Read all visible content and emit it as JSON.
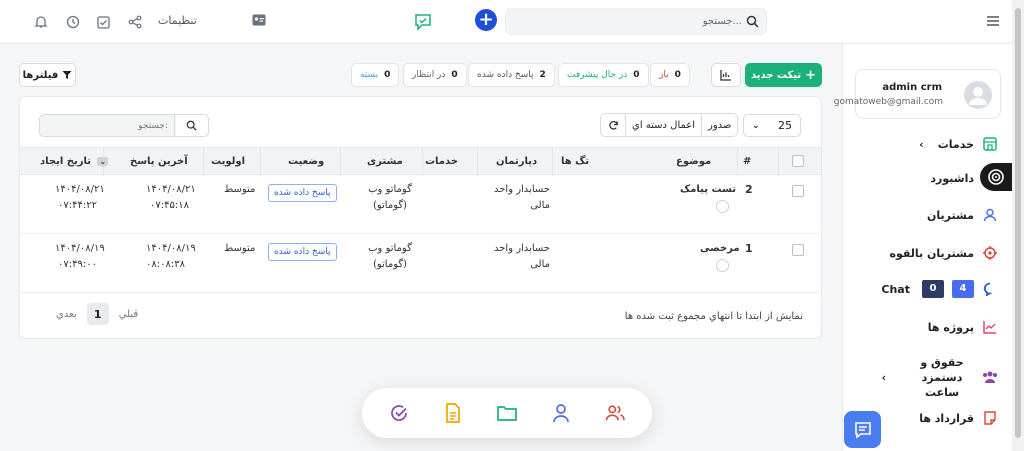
{
  "topbar": {
    "settings_label": "تنظیمات",
    "search_placeholder": "جستجو...",
    "icons": [
      "bell-icon",
      "clock-icon",
      "checkbox-icon",
      "share-icon",
      "id-card-icon",
      "chat-icon",
      "plus-icon",
      "search-icon",
      "hamburger-icon"
    ]
  },
  "colors": {
    "primary": "#1f4fd6",
    "success": "#1bb17a",
    "accent_blue": "#4a7df0"
  },
  "toolbar": {
    "filters_label": "فیلترها",
    "new_ticket_label": "تیکت جدید",
    "statuses": [
      {
        "label": "بسته",
        "count": "0",
        "color": "#2aa7c9"
      },
      {
        "label": "در انتظار",
        "count": "0",
        "color": "#666666"
      },
      {
        "label": "پاسخ داده شده",
        "count": "2",
        "color": "#555555"
      },
      {
        "label": "در حال پیشرفت",
        "count": "0",
        "color": "#1bb17a"
      },
      {
        "label": "باز",
        "count": "0",
        "color": "#e0453a"
      }
    ]
  },
  "panel": {
    "search_placeholder": "جستجو:",
    "bulk_action_label": "اعمال دسته اي",
    "export_label": "صدور",
    "per_page": "25",
    "columns": {
      "num": "#",
      "subject": "موضوع",
      "tags": "تگ ها",
      "department": "دپارتمان",
      "services": "خدمات",
      "customer": "مشتری",
      "status": "وضعیت",
      "priority": "اولویت",
      "last_reply": "آخرین پاسخ",
      "created": "تاریخ ایجاد"
    },
    "rows": [
      {
        "num": "2",
        "subject": "تست پیامک",
        "department": "حسابدار واحد مالی",
        "customer": "گوماتو وب (گوماتو)",
        "status": "پاسخ داده شده",
        "priority": "متوسط",
        "last_reply_date": "۱۴۰۴/۰۸/۲۱",
        "last_reply_time": "۰۷:۴۵:۱۸",
        "created_date": "۱۴۰۴/۰۸/۲۱",
        "created_time": "۰۷:۴۴:۲۲"
      },
      {
        "num": "1",
        "subject": "مرخصی",
        "department": "حسابدار واحد مالی",
        "customer": "گوماتو وب (گوماتو)",
        "status": "پاسخ داده شده",
        "priority": "متوسط",
        "last_reply_date": "۱۴۰۴/۰۸/۱۹",
        "last_reply_time": "۰۸:۰۸:۳۸",
        "created_date": "۱۴۰۴/۰۸/۱۹",
        "created_time": "۰۷:۴۹:۰۰"
      }
    ],
    "footer_info": "نمایش از ابتدا تا انتهاي مجموع ثبت شده ها",
    "pager": {
      "prev": "قبلي",
      "current": "1",
      "next": "بعدي"
    }
  },
  "sidebar": {
    "profile": {
      "name": "admin crm",
      "email": "gomatoweb@gmail.com"
    },
    "items": [
      {
        "label": "خدمات",
        "icon": "store-icon",
        "color": "#1bb17a"
      },
      {
        "label": "داشبورد",
        "icon": "dashboard-icon",
        "color": "#f0a500"
      },
      {
        "label": "مشتریان",
        "icon": "user-icon",
        "color": "#4a6cf0"
      },
      {
        "label": "مشتریان بالقوه",
        "icon": "crosshair-icon",
        "color": "#e0453a"
      },
      {
        "label": "Chat",
        "icon": "chat-bubble-icon",
        "color": "#2c62c9",
        "badge_a": "4",
        "badge_b": "0"
      },
      {
        "label": "پروژه ها",
        "icon": "chart-icon",
        "color": "#e0457b"
      },
      {
        "label": "حقوق و دستمزد ساعت",
        "icon": "team-icon",
        "color": "#8e44ad"
      },
      {
        "label": "قرارداد ها",
        "icon": "contract-icon",
        "color": "#e0453a"
      }
    ]
  },
  "dock": {
    "icons": [
      "team-icon",
      "user-icon",
      "folder-icon",
      "document-icon",
      "check-circle-icon"
    ]
  }
}
